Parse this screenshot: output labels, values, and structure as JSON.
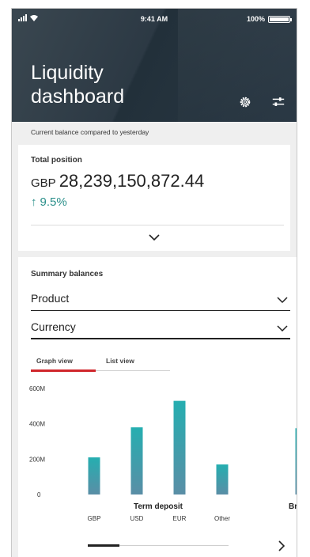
{
  "status_bar": {
    "time": "9:41 AM",
    "battery": "100%"
  },
  "header": {
    "title": "Liquidity dashboard",
    "icons": [
      "gear-icon",
      "filter-sliders-icon"
    ]
  },
  "subtitle": "Current balance compared to yesterday",
  "total": {
    "label": "Total position",
    "currency": "GBP",
    "amount": "28,239,150,872.44",
    "change": "9.5%",
    "change_direction": "up",
    "accent_color": "#2a8f8a"
  },
  "summary": {
    "label": "Summary balances",
    "product_select": "Product",
    "currency_select": "Currency",
    "tabs": [
      {
        "label": "Graph view",
        "active": true
      },
      {
        "label": "List view",
        "active": false
      }
    ],
    "tab_accent": "#d0262b"
  },
  "chart_data": {
    "type": "bar",
    "groups": [
      {
        "name": "Term deposit",
        "categories": [
          "GBP",
          "USD",
          "EUR",
          "Other"
        ],
        "values": [
          210,
          380,
          530,
          170
        ]
      },
      {
        "name": "Br",
        "categories": [],
        "values": [
          375
        ]
      }
    ],
    "y_ticks": [
      "600M",
      "400M",
      "200M",
      "0"
    ],
    "ylim": [
      0,
      600
    ],
    "unit": "M",
    "bar_color_top": "#25aeb0",
    "bar_color_bottom": "#5a8ea6",
    "grid": false
  }
}
